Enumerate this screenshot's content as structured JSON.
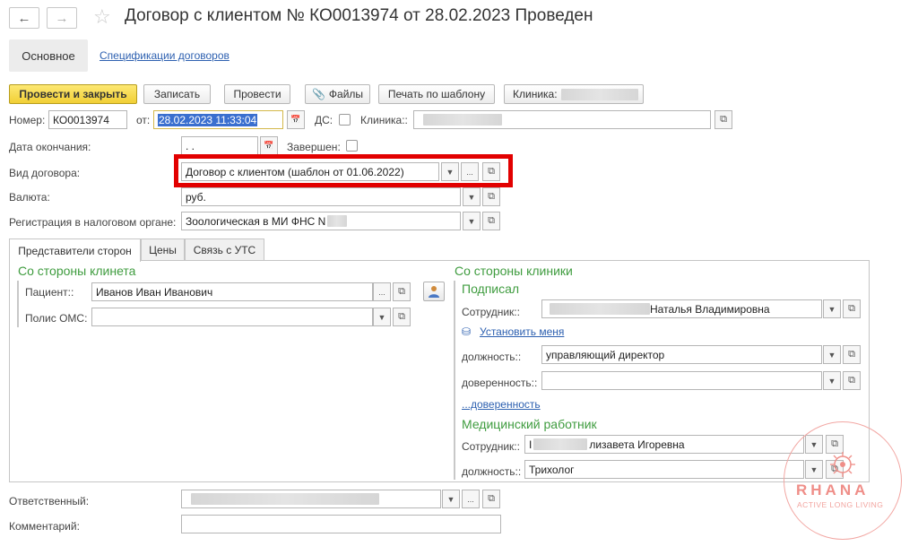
{
  "title": "Договор с клиентом № КО0013974 от 28.02.2023 Проведен",
  "tabs": {
    "main": "Основное",
    "specs": "Спецификации договоров"
  },
  "toolbar": {
    "post_close": "Провести и закрыть",
    "save": "Записать",
    "post": "Провести",
    "files": "Файлы",
    "print": "Печать по шаблону",
    "clinic": "Клиника:"
  },
  "form": {
    "number_label": "Номер:",
    "number": "КО0013974",
    "from_label": "от:",
    "from_value": "28.02.2023 11:33:04",
    "ds_label": "ДС:",
    "clinic_label": "Клиника::",
    "end_date_label": "Дата окончания:",
    "end_date_value": " .  .",
    "completed_label": "Завершен:",
    "contract_type_label": "Вид договора:",
    "contract_type_value": "Договор с клиентом (шаблон от 01.06.2022)",
    "currency_label": "Валюта:",
    "currency_value": "руб.",
    "tax_label": "Регистрация в налоговом органе:",
    "tax_value": "Зоологическая в МИ ФНС N",
    "responsible_label": "Ответственный:",
    "comment_label": "Комментарий:"
  },
  "inner_tabs": [
    "Представители сторон",
    "Цены",
    "Связь с УТС"
  ],
  "client_side": {
    "heading": "Со стороны клинета",
    "patient_label": "Пациент::",
    "patient_value": "Иванов Иван Иванович",
    "policy_label": "Полис ОМС:"
  },
  "clinic_side": {
    "heading": "Со стороны клиники",
    "signed_heading": "Подписал",
    "employee_label": "Сотрудник::",
    "employee_value": "Наталья Владимировна",
    "set_me": "Установить меня",
    "position_label": "должность::",
    "position_value": "управляющий директор",
    "proxy_label": "доверенность::",
    "proxy_link": "...доверенность",
    "med_heading": "Медицинский работник",
    "med_employee_label": "Сотрудник::",
    "med_employee_value": "лизавета Игоревна",
    "med_position_label": "должность::",
    "med_position_value": "Трихолог"
  },
  "watermark": {
    "brand": "RHANA",
    "tagline": "ACTIVE LONG LIVING"
  },
  "icons": [
    "back-arrow-icon",
    "forward-arrow-icon",
    "star-icon",
    "paperclip-icon",
    "calendar-icon",
    "dropdown-arrow-icon",
    "open-icon",
    "person-pick-icon"
  ]
}
